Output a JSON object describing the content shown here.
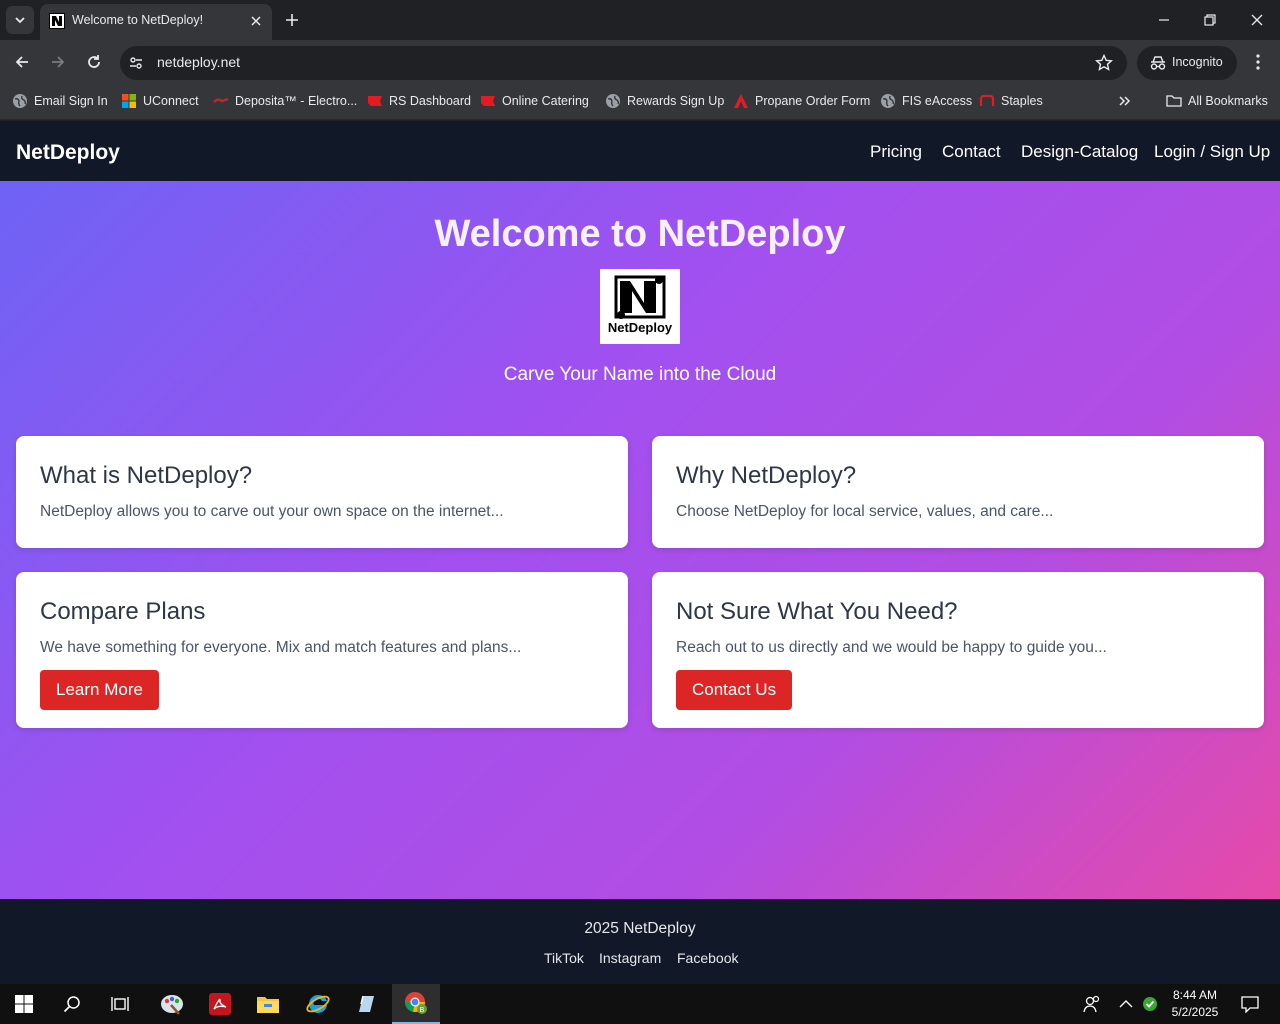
{
  "browser": {
    "tab_title": "Welcome to NetDeploy!",
    "url": "netdeploy.net",
    "incognito_label": "Incognito",
    "bookmarks": [
      {
        "label": "Email Sign In",
        "icon": "globe-icon"
      },
      {
        "label": "UConnect",
        "icon": "microsoft-icon"
      },
      {
        "label": "Deposita™ - Electro...",
        "icon": "deposita-icon"
      },
      {
        "label": "RS Dashboard",
        "icon": "red-flag-icon"
      },
      {
        "label": "Online Catering",
        "icon": "red-flag-icon"
      },
      {
        "label": "Rewards Sign Up",
        "icon": "globe-icon"
      },
      {
        "label": "Propane Order Form",
        "icon": "adobe-icon"
      },
      {
        "label": "FIS eAccess",
        "icon": "globe-icon"
      },
      {
        "label": "Staples",
        "icon": "staples-icon"
      }
    ],
    "all_bookmarks_label": "All Bookmarks"
  },
  "site": {
    "brand": "NetDeploy",
    "nav": {
      "pricing": "Pricing",
      "contact": "Contact",
      "design_catalog": "Design-Catalog",
      "login": "Login / Sign Up"
    },
    "hero": {
      "title": "Welcome to NetDeploy",
      "logo_text": "NetDeploy",
      "tagline": "Carve Your Name into the Cloud"
    },
    "cards": [
      {
        "title": "What is NetDeploy?",
        "body": "NetDeploy allows you to carve out your own space on the internet..."
      },
      {
        "title": "Why NetDeploy?",
        "body": "Choose NetDeploy for local service, values, and care..."
      },
      {
        "title": "Compare Plans",
        "body": "We have something for everyone. Mix and match features and plans...",
        "button": "Learn More"
      },
      {
        "title": "Not Sure What You Need?",
        "body": "Reach out to us directly and we would be happy to guide you...",
        "button": "Contact Us"
      }
    ],
    "footer": {
      "copyright": "2025 NetDeploy",
      "links": [
        "TikTok",
        "Instagram",
        "Facebook"
      ]
    }
  },
  "taskbar": {
    "time": "8:44 AM",
    "date": "5/2/2025"
  },
  "colors": {
    "nav_bg": "#111827",
    "button_red": "#dc2626",
    "hero_gradient_start": "#6e63f5",
    "hero_gradient_end": "#e64aa8"
  }
}
